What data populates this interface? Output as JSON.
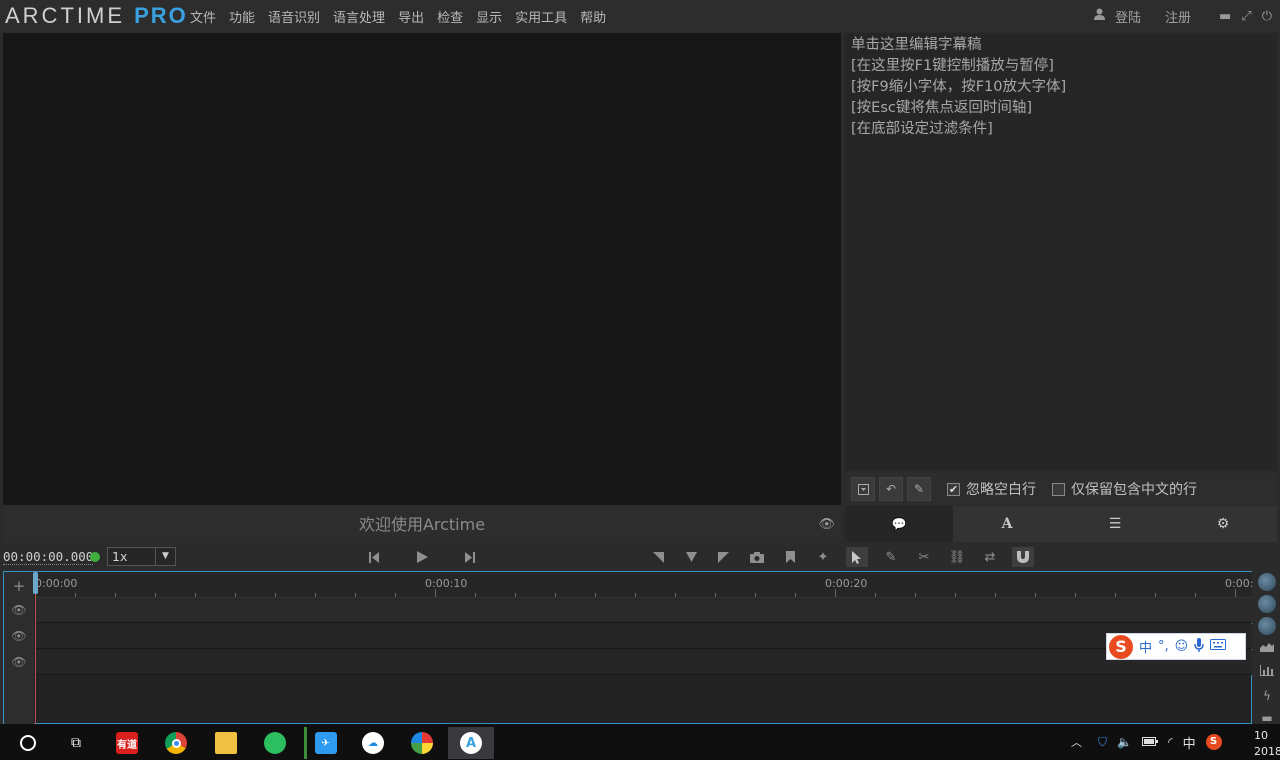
{
  "app": {
    "logo_main": "ARCTIME",
    "logo_pro": "PRO"
  },
  "menu": [
    "文件",
    "功能",
    "语音识别",
    "语言处理",
    "导出",
    "检查",
    "显示",
    "实用工具",
    "帮助"
  ],
  "account": {
    "login": "登陆",
    "register": "注册"
  },
  "player": {
    "welcome": "欢迎使用Arctime"
  },
  "editor": {
    "lines": [
      "单击这里编辑字幕稿",
      "[在这里按F1键控制播放与暂停]",
      "[按F9缩小字体，按F10放大字体]",
      "[按Esc键将焦点返回时间轴]",
      "[在底部设定过滤条件]"
    ]
  },
  "filters": {
    "ignore_blank": "忽略空白行",
    "ignore_blank_checked": true,
    "keep_chinese": "仅保留包含中文的行",
    "keep_chinese_checked": false
  },
  "tabs": [
    {
      "icon": "speech-bubble-icon",
      "glyph": "💬"
    },
    {
      "icon": "font-icon",
      "glyph": "A"
    },
    {
      "icon": "list-icon",
      "glyph": "☰"
    },
    {
      "icon": "gear-icon",
      "glyph": "⚙"
    }
  ],
  "transport": {
    "timecode": "00:00:00.000",
    "speed": "1x"
  },
  "ruler": {
    "labels": [
      "0:00:00",
      "0:00:10",
      "0:00:20",
      "0:00:"
    ]
  },
  "ime": {
    "mode": "中",
    "punct": "°,"
  },
  "taskbar": {
    "youdao": "有道",
    "tray_lang": "中",
    "clock_top": "10",
    "clock_bottom": "2018"
  },
  "colors": {
    "accent": "#3aa0e0",
    "timeline_border": "#3a90c0",
    "playhead": "#c05050",
    "status_dot": "#3fae3f",
    "sogou": "#e84b1f"
  }
}
